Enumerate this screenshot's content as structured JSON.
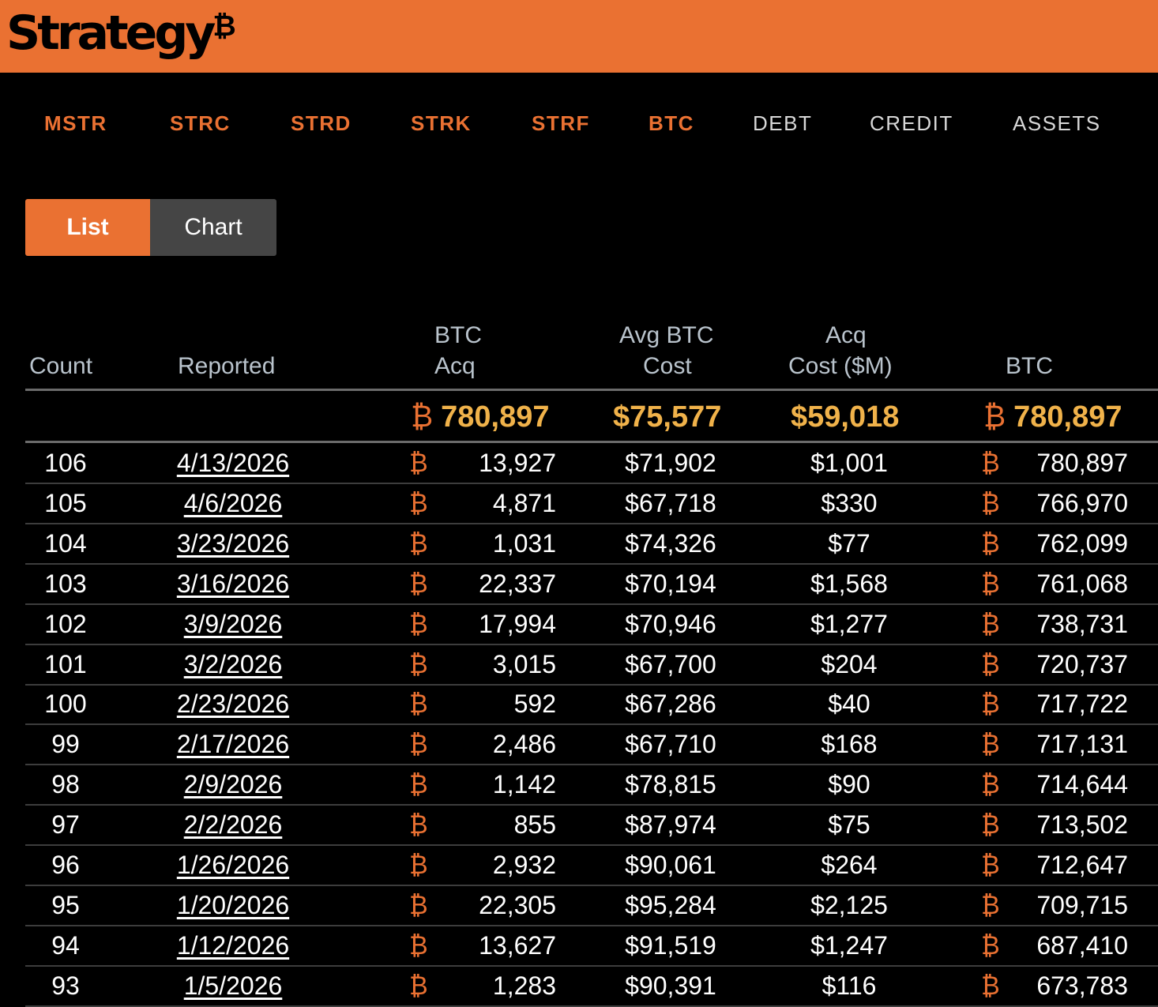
{
  "brand": {
    "name": "Strategy",
    "mark": "₿"
  },
  "nav": {
    "items": [
      {
        "label": "MSTR"
      },
      {
        "label": "STRC"
      },
      {
        "label": "STRD"
      },
      {
        "label": "STRK"
      },
      {
        "label": "STRF"
      },
      {
        "label": "BTC"
      },
      {
        "label": "DEBT"
      },
      {
        "label": "CREDIT"
      },
      {
        "label": "ASSETS"
      }
    ]
  },
  "view_toggle": {
    "list_label": "List",
    "chart_label": "Chart",
    "active": "List"
  },
  "table": {
    "headers": {
      "count": "Count",
      "reported": "Reported",
      "btc_acq_1": "BTC",
      "btc_acq_2": "Acq",
      "avg_cost_1": "Avg BTC",
      "avg_cost_2": "Cost",
      "acq_cost_1": "Acq",
      "acq_cost_2": "Cost ($M)",
      "btc": "BTC"
    },
    "btc_symbol": "₿",
    "totals": {
      "btc_acq": "780,897",
      "avg_cost": "$75,577",
      "acq_cost": "$59,018",
      "btc": "780,897"
    },
    "rows": [
      {
        "count": "106",
        "reported": "4/13/2026",
        "btc_acq": "13,927",
        "avg_cost": "$71,902",
        "acq_cost": "$1,001",
        "btc": "780,897"
      },
      {
        "count": "105",
        "reported": "4/6/2026",
        "btc_acq": "4,871",
        "avg_cost": "$67,718",
        "acq_cost": "$330",
        "btc": "766,970"
      },
      {
        "count": "104",
        "reported": "3/23/2026",
        "btc_acq": "1,031",
        "avg_cost": "$74,326",
        "acq_cost": "$77",
        "btc": "762,099"
      },
      {
        "count": "103",
        "reported": "3/16/2026",
        "btc_acq": "22,337",
        "avg_cost": "$70,194",
        "acq_cost": "$1,568",
        "btc": "761,068"
      },
      {
        "count": "102",
        "reported": "3/9/2026",
        "btc_acq": "17,994",
        "avg_cost": "$70,946",
        "acq_cost": "$1,277",
        "btc": "738,731"
      },
      {
        "count": "101",
        "reported": "3/2/2026",
        "btc_acq": "3,015",
        "avg_cost": "$67,700",
        "acq_cost": "$204",
        "btc": "720,737"
      },
      {
        "count": "100",
        "reported": "2/23/2026",
        "btc_acq": "592",
        "avg_cost": "$67,286",
        "acq_cost": "$40",
        "btc": "717,722"
      },
      {
        "count": "99",
        "reported": "2/17/2026",
        "btc_acq": "2,486",
        "avg_cost": "$67,710",
        "acq_cost": "$168",
        "btc": "717,131"
      },
      {
        "count": "98",
        "reported": "2/9/2026",
        "btc_acq": "1,142",
        "avg_cost": "$78,815",
        "acq_cost": "$90",
        "btc": "714,644"
      },
      {
        "count": "97",
        "reported": "2/2/2026",
        "btc_acq": "855",
        "avg_cost": "$87,974",
        "acq_cost": "$75",
        "btc": "713,502"
      },
      {
        "count": "96",
        "reported": "1/26/2026",
        "btc_acq": "2,932",
        "avg_cost": "$90,061",
        "acq_cost": "$264",
        "btc": "712,647"
      },
      {
        "count": "95",
        "reported": "1/20/2026",
        "btc_acq": "22,305",
        "avg_cost": "$95,284",
        "acq_cost": "$2,125",
        "btc": "709,715"
      },
      {
        "count": "94",
        "reported": "1/12/2026",
        "btc_acq": "13,627",
        "avg_cost": "$91,519",
        "acq_cost": "$1,247",
        "btc": "687,410"
      },
      {
        "count": "93",
        "reported": "1/5/2026",
        "btc_acq": "1,283",
        "avg_cost": "$90,391",
        "acq_cost": "$116",
        "btc": "673,783"
      }
    ]
  },
  "colors": {
    "accent": "#ea7132",
    "total_gold": "#f0b24a",
    "header_text": "#b9c3cc",
    "background": "#000000"
  }
}
